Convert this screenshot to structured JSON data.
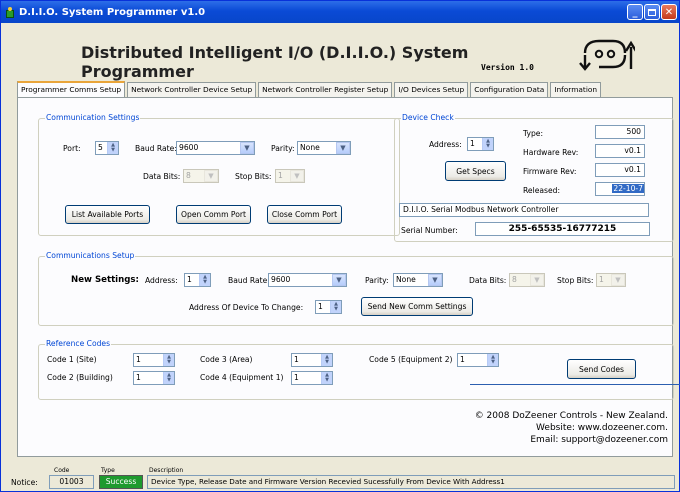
{
  "window": {
    "title": "D.I.I.O. System Programmer v1.0"
  },
  "header": {
    "title": "Distributed Intelligent I/O (D.I.I.O.) System Programmer",
    "version": "Version 1.0"
  },
  "tabs": [
    "Programmer Comms Setup",
    "Network Controller Device Setup",
    "Network Controller Register Setup",
    "I/O Devices Setup",
    "Configuration Data",
    "Information"
  ],
  "comm": {
    "title": "Communication Settings",
    "port_label": "Port:",
    "port": "5",
    "baud_label": "Baud Rate:",
    "baud": "9600",
    "parity_label": "Parity:",
    "parity": "None",
    "databits_label": "Data Bits:",
    "databits": "8",
    "stopbits_label": "Stop Bits:",
    "stopbits": "1",
    "list_btn": "List Available Ports",
    "open_btn": "Open Comm Port",
    "close_btn": "Close Comm Port"
  },
  "device": {
    "title": "Device Check",
    "address_label": "Address:",
    "address": "1",
    "getspecs_btn": "Get Specs",
    "type_label": "Type:",
    "type": "500",
    "hwrev_label": "Hardware Rev:",
    "hwrev": "v0.1",
    "fwrev_label": "Firmware Rev:",
    "fwrev": "v0.1",
    "released_label": "Released:",
    "released": "22-10-7",
    "name": "D.I.I.O. Serial Modbus Network Controller",
    "serial_label": "Serial Number:",
    "serial": "255-65535-16777215"
  },
  "setup": {
    "title": "Communications Setup",
    "new_label": "New Settings:",
    "address_label": "Address:",
    "address": "1",
    "baud_label": "Baud Rate:",
    "baud": "9600",
    "parity_label": "Parity:",
    "parity": "None",
    "databits_label": "Data Bits:",
    "databits": "8",
    "stopbits_label": "Stop Bits:",
    "stopbits": "1",
    "change_label": "Address Of Device To Change:",
    "change": "1",
    "send_btn": "Send New Comm Settings"
  },
  "codes": {
    "title": "Reference Codes",
    "c1_label": "Code 1 (Site)",
    "c1": "1",
    "c2_label": "Code 2 (Building)",
    "c2": "1",
    "c3_label": "Code 3 (Area)",
    "c3": "1",
    "c4_label": "Code 4 (Equipment 1)",
    "c4": "1",
    "c5_label": "Code 5 (Equipment 2)",
    "c5": "1",
    "send_btn": "Send Codes"
  },
  "footer": {
    "copyright": "© 2008 DoZeener Controls - New Zealand.",
    "website": "Website: www.dozeener.com.",
    "email": "Email: support@dozeener.com"
  },
  "notice": {
    "label": "Notice:",
    "code_hdr": "Code",
    "type_hdr": "Type",
    "desc_hdr": "Description",
    "code": "01003",
    "type": "Success",
    "description": "Device Type, Release Date and Firmware Version Recevied Sucessfully From Device With Address1"
  },
  "colors": {
    "success": "#1e9a2e",
    "group_title": "#0046d5",
    "tab_highlight": "#e9a53a"
  }
}
